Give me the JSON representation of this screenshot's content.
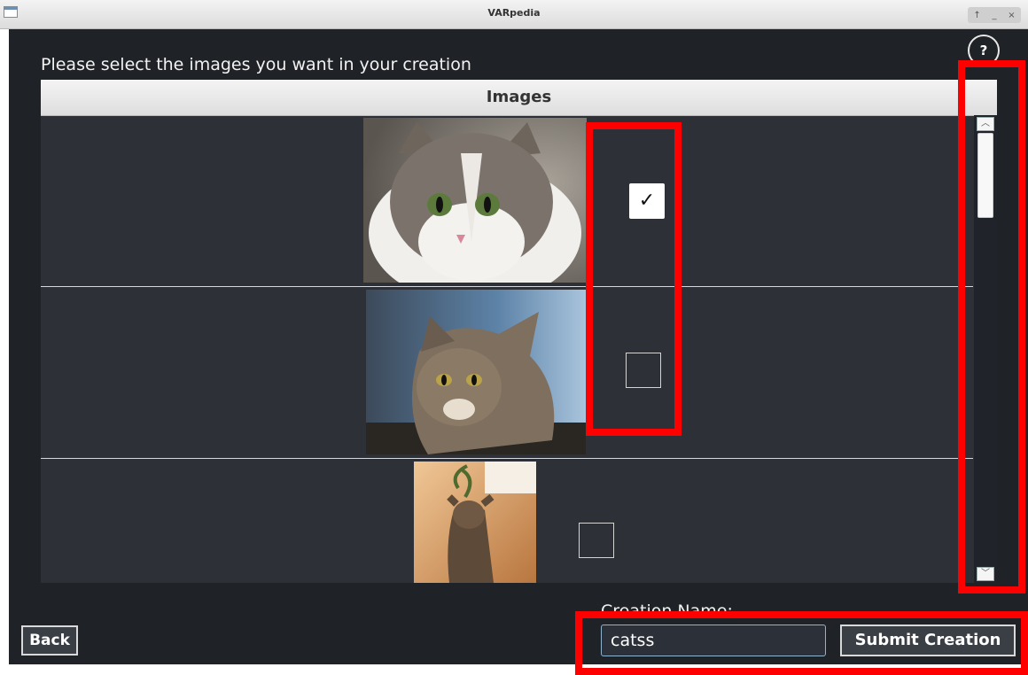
{
  "window": {
    "title": "VARpedia",
    "controls": "↑ _ ×"
  },
  "help": {
    "label": "?"
  },
  "prompt": "Please select the images you want in your creation",
  "table": {
    "header": "Images",
    "rows": [
      {
        "image": "cat-photo-1",
        "checked": true,
        "check_glyph": "✓"
      },
      {
        "image": "cat-photo-2",
        "checked": false,
        "check_glyph": ""
      },
      {
        "image": "cat-photo-3",
        "checked": false,
        "check_glyph": ""
      }
    ],
    "scroll_position": 0.0
  },
  "footer": {
    "back_label": "Back",
    "creation_name_label": "Creation Name:",
    "creation_name_value": "catss",
    "submit_label": "Submit Creation"
  },
  "colors": {
    "background": "#1f2226",
    "table": "#2d3037",
    "highlight": "#ff0000"
  }
}
